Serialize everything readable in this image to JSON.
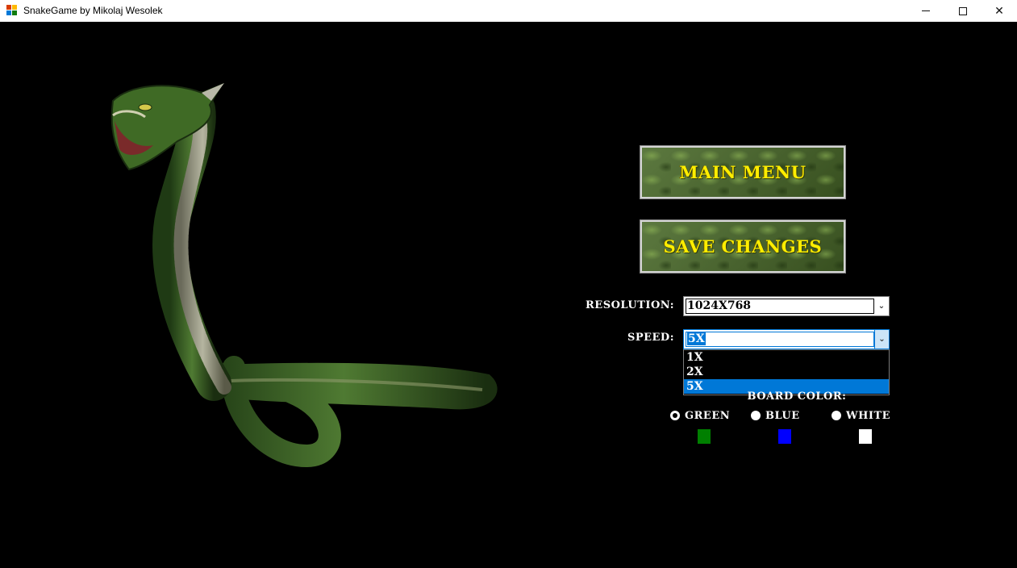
{
  "window": {
    "title": "SnakeGame by Mikolaj Wesolek",
    "min_glyph": "",
    "close_glyph": "✕"
  },
  "buttons": {
    "main_menu": "MAIN MENU",
    "save_changes": "SAVE CHANGES"
  },
  "settings": {
    "resolution_label": "RESOLUTION:",
    "resolution_value": "1024X768",
    "speed_label": "SPEED:",
    "speed_value": "5X",
    "speed_options": [
      "1X",
      "2X",
      "5X"
    ],
    "speed_selected_index": 2,
    "board_color_label": "BOARD COLOR:",
    "board_colors": [
      {
        "label": "GREEN",
        "swatch": "#007f00",
        "checked": true
      },
      {
        "label": "BLUE",
        "swatch": "#0000ff",
        "checked": false
      },
      {
        "label": "WHITE",
        "swatch": "#ffffff",
        "checked": false
      }
    ]
  },
  "icons": {
    "dropdown_arrow": "⌄"
  },
  "colors": {
    "button_text": "#ffee00",
    "selection": "#0078d7",
    "background": "#000000"
  }
}
